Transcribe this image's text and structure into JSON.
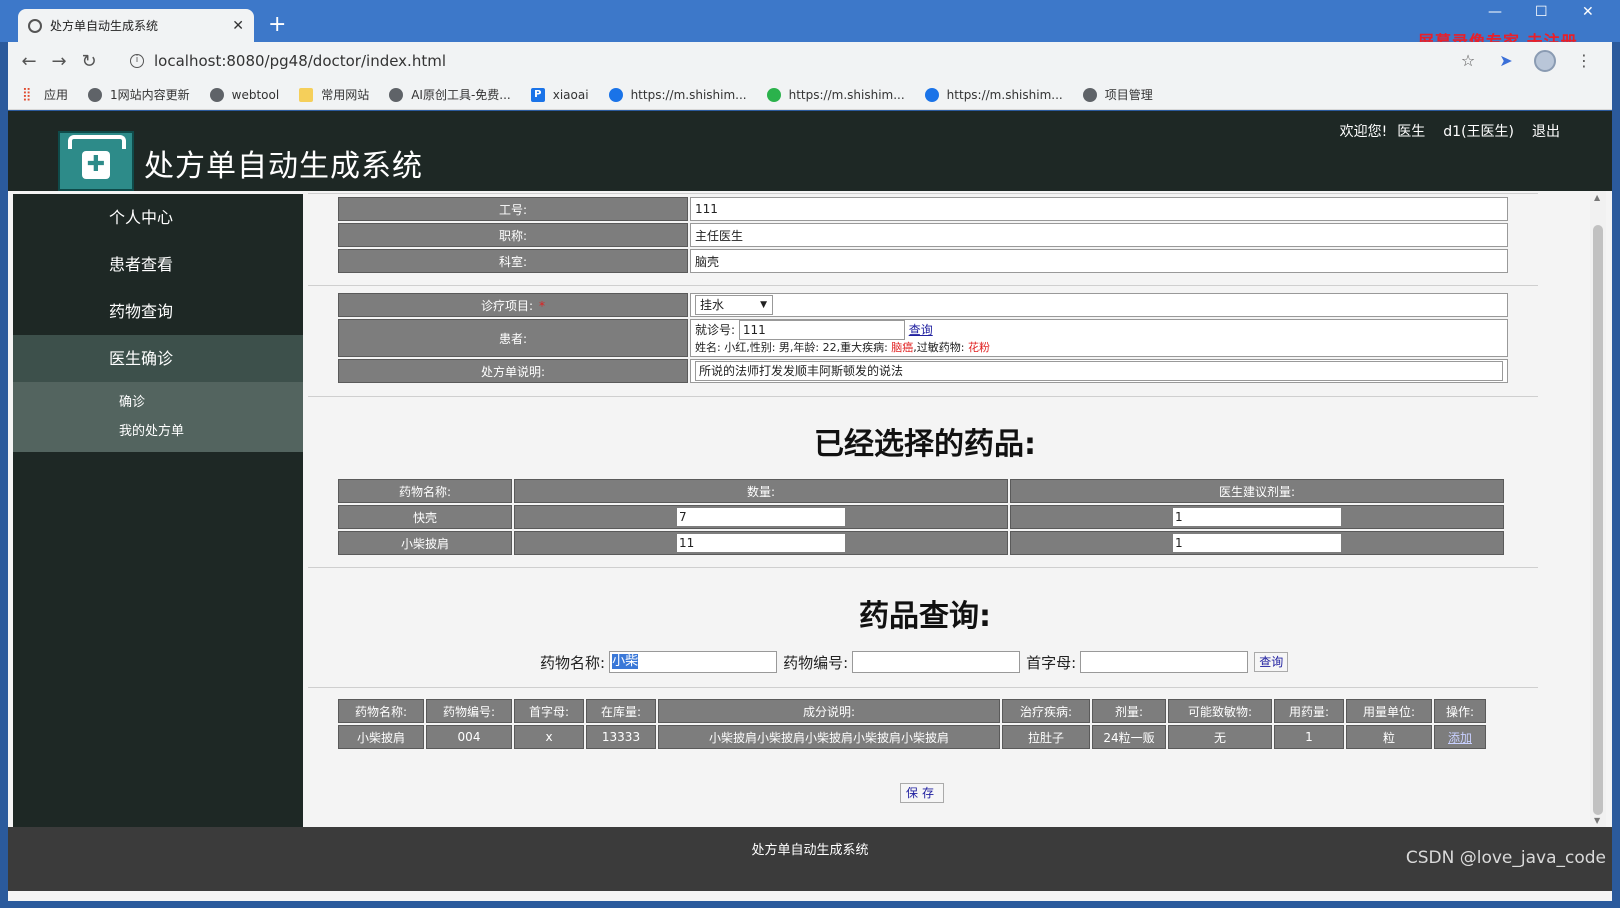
{
  "browser": {
    "tab_title": "处方单自动生成系统",
    "url": "localhost:8080/pg48/doctor/index.html",
    "watermark": "屏幕录像专家 未注册",
    "bookmarks": [
      "应用",
      "1网站内容更新",
      "webtool",
      "常用网站",
      "AI原创工具-免费...",
      "xiaoai",
      "https://m.shishim...",
      "https://m.shishim...",
      "https://m.shishim...",
      "项目管理"
    ]
  },
  "header": {
    "title": "处方单自动生成系统",
    "welcome": "欢迎您!",
    "role": "医生",
    "user": "d1(王医生)",
    "logout": "退出"
  },
  "sidebar": {
    "items": [
      {
        "label": "个人中心"
      },
      {
        "label": "患者查看"
      },
      {
        "label": "药物查询"
      },
      {
        "label": "医生确诊"
      }
    ],
    "subitems": [
      {
        "label": "确诊"
      },
      {
        "label": "我的处方单"
      }
    ]
  },
  "doctor_info": {
    "job_no_label": "工号:",
    "job_no": "111",
    "title_label": "职称:",
    "title": "主任医生",
    "dept_label": "科室:",
    "dept": "脑壳"
  },
  "diagnosis": {
    "item_label": "诊疗项目:",
    "item_required": "*",
    "item_value": "挂水",
    "patient_label": "患者:",
    "visit_no_label": "就诊号:",
    "visit_no": "111",
    "query_link": "查询",
    "patient_info_prefix": "姓名: 小红,性别: 男,年龄: 22,重大疾病: ",
    "major_disease": "脑癌",
    "allergy_prefix": ",过敏药物: ",
    "allergy": "花粉",
    "note_label": "处方单说明:",
    "note_value": "所说的法师打发发顺丰阿斯顿发的说法"
  },
  "selected": {
    "title": "已经选择的药品:",
    "headers": [
      "药物名称:",
      "数量:",
      "医生建议剂量:"
    ],
    "rows": [
      {
        "name": "快壳",
        "qty": "7",
        "dose": "1"
      },
      {
        "name": "小柴披肩",
        "qty": "11",
        "dose": "1"
      }
    ]
  },
  "drug_search": {
    "title": "药品查询:",
    "name_label": "药物名称:",
    "name_value": "小柴",
    "code_label": "药物编号:",
    "code_value": "",
    "initial_label": "首字母:",
    "initial_value": "",
    "query_button": "查询"
  },
  "results": {
    "headers": [
      "药物名称:",
      "药物编号:",
      "首字母:",
      "在库量:",
      "成分说明:",
      "治疗疾病:",
      "剂量:",
      "可能致敏物:",
      "用药量:",
      "用量单位:",
      "操作:"
    ],
    "rows": [
      {
        "name": "小柴披肩",
        "code": "004",
        "initial": "x",
        "stock": "13333",
        "desc": "小柴披肩小柴披肩小柴披肩小柴披肩小柴披肩",
        "disease": "拉肚子",
        "dose": "24粒一贩",
        "allergen": "无",
        "amount": "1",
        "unit": "粒",
        "action": "添加"
      }
    ]
  },
  "save_button": "保存",
  "footer": "处方单自动生成系统",
  "csdn": "CSDN @love_java_code"
}
